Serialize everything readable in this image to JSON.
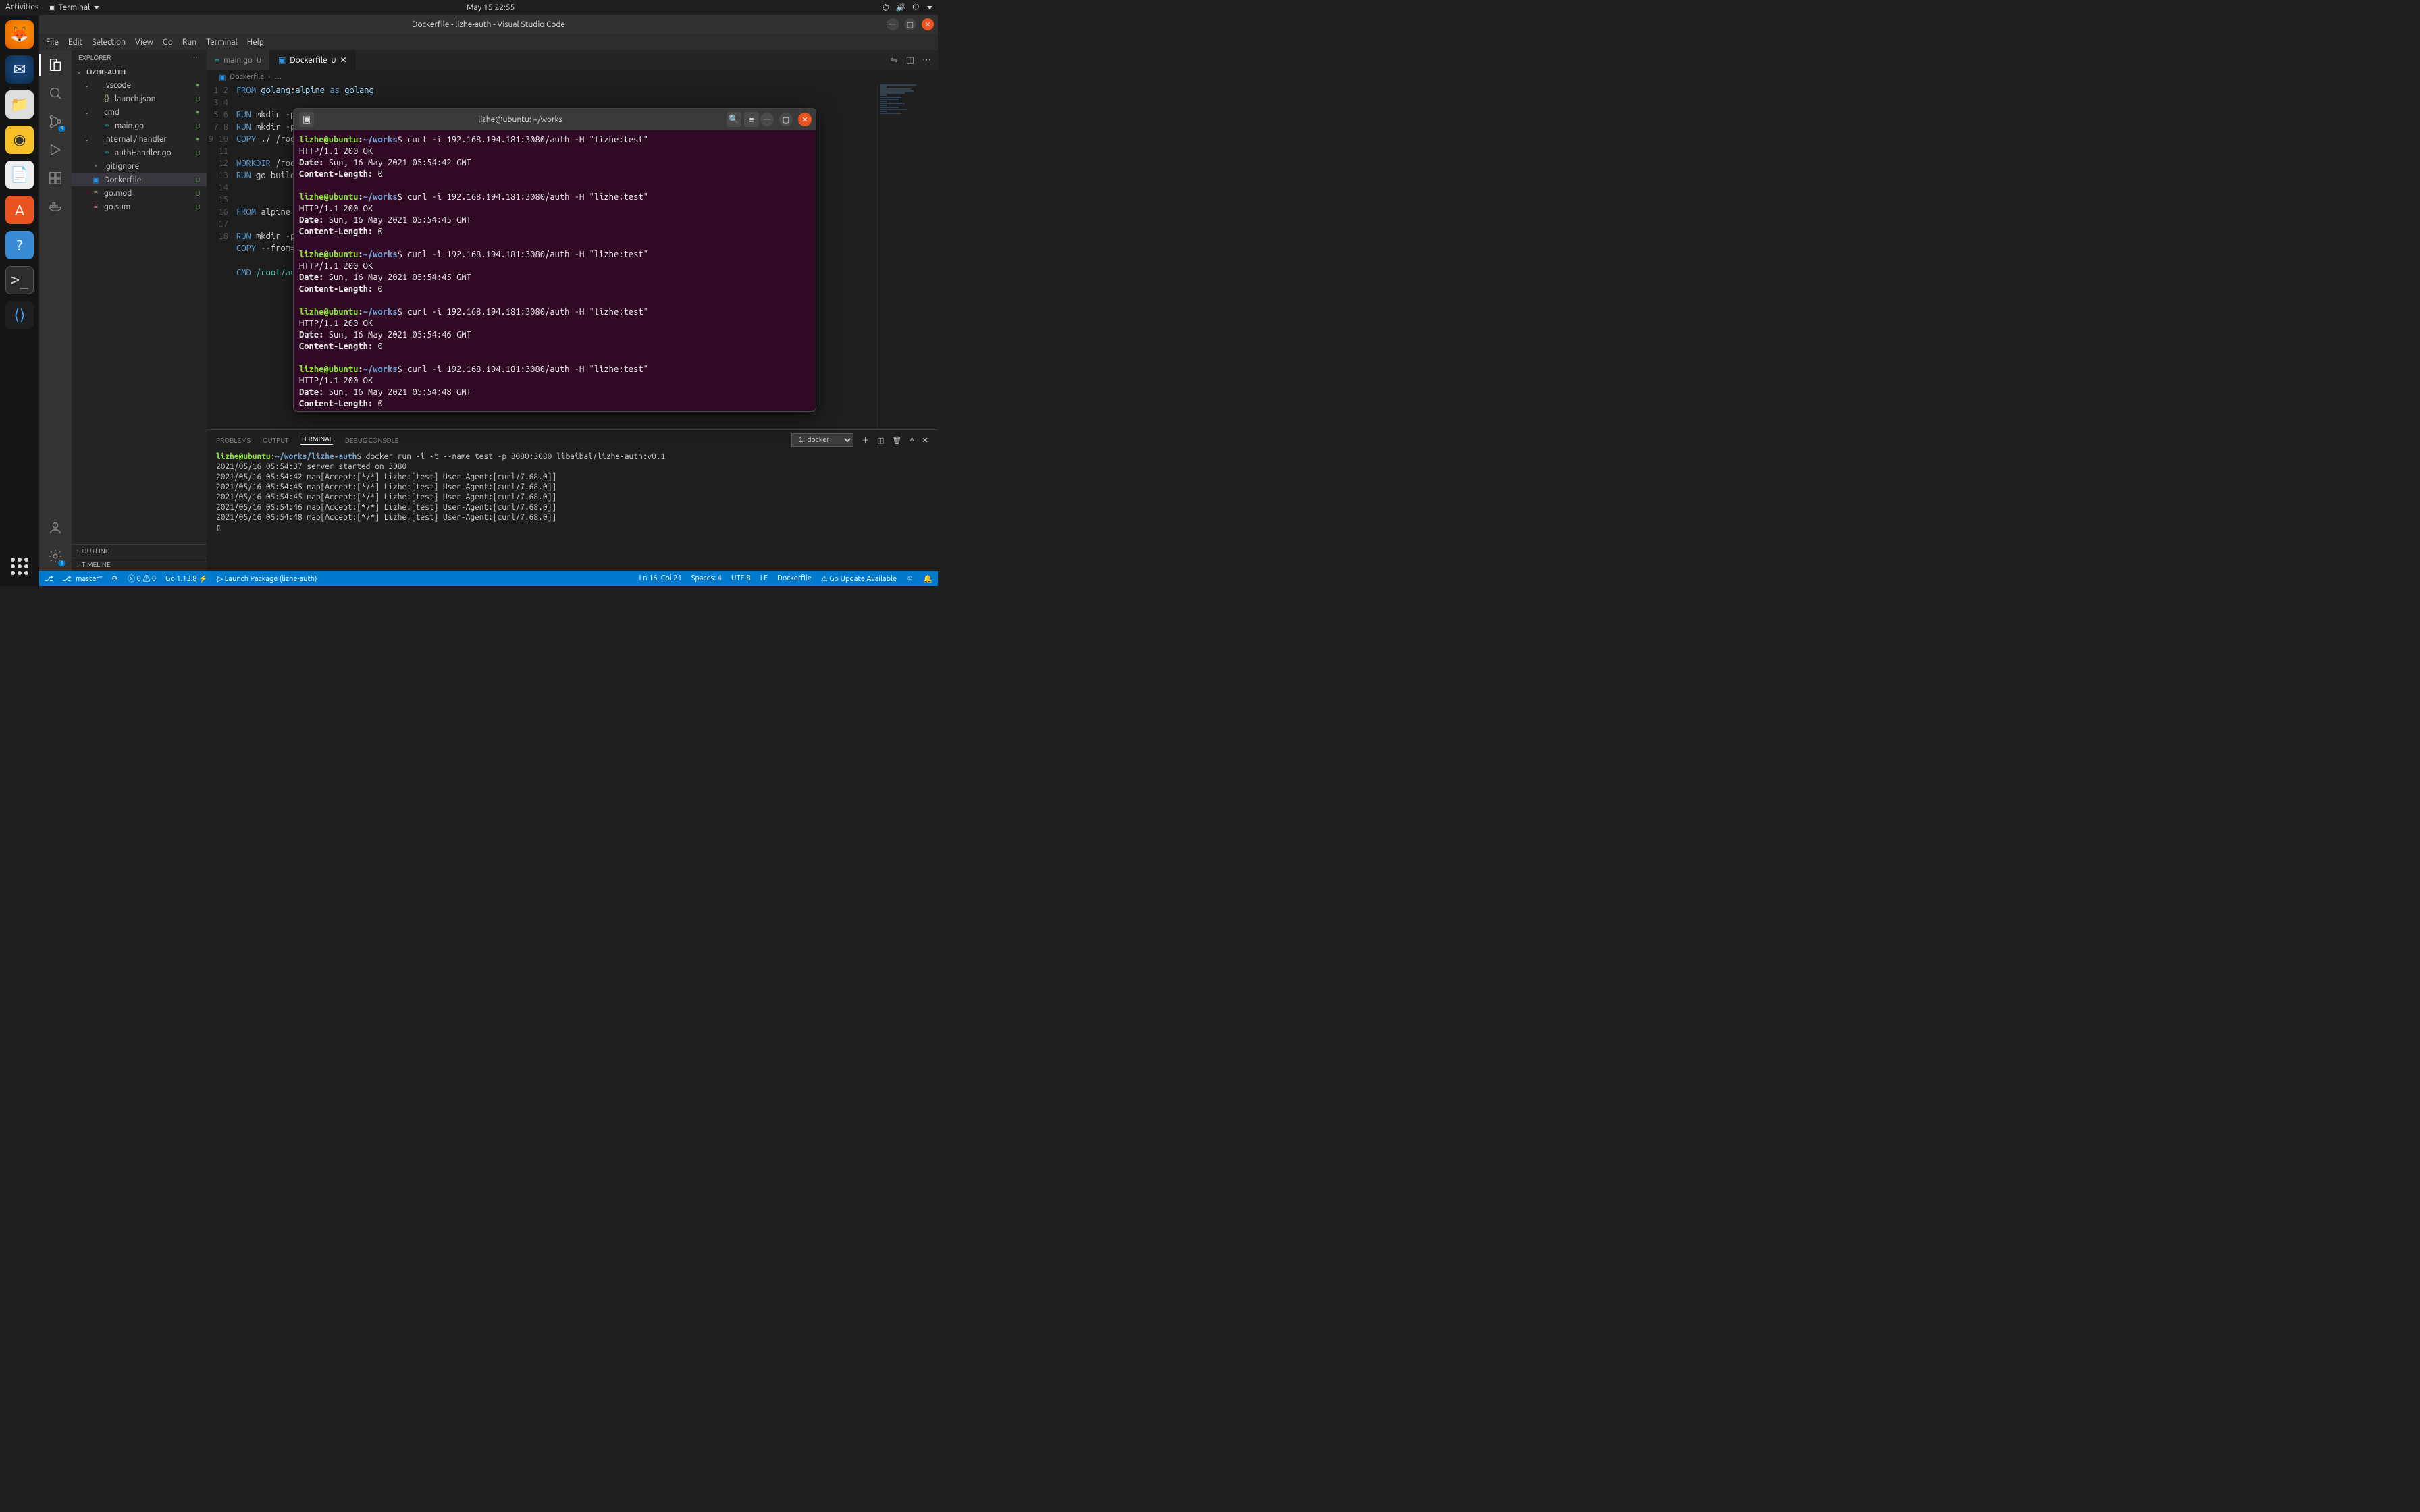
{
  "gnome": {
    "activities": "Activities",
    "app_indicator": "Terminal",
    "clock": "May 15  22:55"
  },
  "dock_icons": [
    "firefox",
    "thunderbird",
    "files",
    "rhythmbox",
    "writer",
    "software",
    "help",
    "terminal",
    "vscode"
  ],
  "vscode": {
    "title": "Dockerfile - lizhe-auth - Visual Studio Code",
    "menu": [
      "File",
      "Edit",
      "Selection",
      "View",
      "Go",
      "Run",
      "Terminal",
      "Help"
    ],
    "explorer": {
      "title": "EXPLORER",
      "root": "LIZHE-AUTH",
      "tree": [
        {
          "depth": 1,
          "type": "folder",
          "open": true,
          "name": ".vscode",
          "status": "●",
          "cls": "dot"
        },
        {
          "depth": 2,
          "type": "file",
          "icon": "{}",
          "iconCls": "json",
          "name": "launch.json",
          "status": "U",
          "cls": "u"
        },
        {
          "depth": 1,
          "type": "folder",
          "open": true,
          "name": "cmd",
          "status": "●",
          "cls": "dot"
        },
        {
          "depth": 2,
          "type": "file",
          "icon": "∞",
          "iconCls": "go",
          "name": "main.go",
          "status": "U",
          "cls": "u"
        },
        {
          "depth": 1,
          "type": "folder",
          "open": true,
          "name": "internal / handler",
          "status": "●",
          "cls": "dot"
        },
        {
          "depth": 2,
          "type": "file",
          "icon": "∞",
          "iconCls": "go",
          "name": "authHandler.go",
          "status": "U",
          "cls": "u"
        },
        {
          "depth": 1,
          "type": "file",
          "icon": "◦",
          "iconCls": "",
          "name": ".gitignore",
          "status": "",
          "cls": ""
        },
        {
          "depth": 1,
          "type": "file",
          "icon": "▣",
          "iconCls": "docker",
          "name": "Dockerfile",
          "status": "U",
          "cls": "u",
          "selected": true
        },
        {
          "depth": 1,
          "type": "file",
          "icon": "≡",
          "iconCls": "mod",
          "name": "go.mod",
          "status": "U",
          "cls": "u"
        },
        {
          "depth": 1,
          "type": "file",
          "icon": "≡",
          "iconCls": "mod",
          "name": "go.sum",
          "status": "U",
          "cls": "u"
        }
      ],
      "outline": "OUTLINE",
      "timeline": "TIMELINE"
    },
    "activitybar_source_badge": "6",
    "tabs": [
      {
        "icon": "∞",
        "iconCls": "go",
        "name": "main.go",
        "modified": true,
        "active": false
      },
      {
        "icon": "▣",
        "iconCls": "docker",
        "name": "Dockerfile",
        "modified": true,
        "active": true
      }
    ],
    "breadcrumb": [
      "Dockerfile",
      "…"
    ],
    "editor_lines": [
      {
        "n": 1,
        "html": "<span class='c-kw'>FROM</span> <span class='c-cmd'>golang</span>:<span class='c-cmd'>alpine</span> <span class='c-kw'>as</span> <span class='c-cmd'>golang</span>"
      },
      {
        "n": 2,
        "html": ""
      },
      {
        "n": 3,
        "html": "<span class='c-kw'>RUN</span> mkdir -p <span class='c-path'>/root/auth</span>"
      },
      {
        "n": 4,
        "html": "<span class='c-kw'>RUN</span> mkdir -p"
      },
      {
        "n": 5,
        "html": "<span class='c-kw'>COPY</span> ./ /root"
      },
      {
        "n": 6,
        "html": ""
      },
      {
        "n": 7,
        "html": "<span class='c-kw'>WORKDIR</span> /root"
      },
      {
        "n": 8,
        "html": "<span class='c-kw'>RUN</span> go build"
      },
      {
        "n": 9,
        "html": ""
      },
      {
        "n": 10,
        "html": ""
      },
      {
        "n": 11,
        "html": "<span class='c-kw'>FROM</span> alpine a"
      },
      {
        "n": 12,
        "html": ""
      },
      {
        "n": 13,
        "html": "<span class='c-kw'>RUN</span> mkdir -p"
      },
      {
        "n": 14,
        "html": "<span class='c-kw'>COPY</span> --from=g"
      },
      {
        "n": 15,
        "html": ""
      },
      {
        "n": 16,
        "html": "<span class='c-kw'>CMD</span> <span class='c-path'>/root/aut</span>"
      },
      {
        "n": 17,
        "html": ""
      },
      {
        "n": 18,
        "html": ""
      }
    ],
    "panel": {
      "tabs": [
        "PROBLEMS",
        "OUTPUT",
        "TERMINAL",
        "DEBUG CONSOLE"
      ],
      "active": "TERMINAL",
      "select": "1: docker",
      "prompt_user": "lizhe@ubuntu",
      "prompt_path": "~/works/lizhe-auth",
      "command": "docker run -i -t --name test -p 3080:3080 libaibai/lizhe-auth:v0.1",
      "output": [
        "2021/05/16 05:54:37 server started on 3080",
        "2021/05/16 05:54:42 map[Accept:[*/*] Lizhe:[test] User-Agent:[curl/7.68.0]]",
        "2021/05/16 05:54:45 map[Accept:[*/*] Lizhe:[test] User-Agent:[curl/7.68.0]]",
        "2021/05/16 05:54:45 map[Accept:[*/*] Lizhe:[test] User-Agent:[curl/7.68.0]]",
        "2021/05/16 05:54:46 map[Accept:[*/*] Lizhe:[test] User-Agent:[curl/7.68.0]]",
        "2021/05/16 05:54:48 map[Accept:[*/*] Lizhe:[test] User-Agent:[curl/7.68.0]]"
      ],
      "cursor": "▯"
    },
    "statusbar": {
      "branch": "master*",
      "errors": "0",
      "warnings": "0",
      "go_ver": "Go 1.13.8",
      "debug_alt": "⚡",
      "launch": "Launch Package (lizhe-auth)",
      "ln_col": "Ln 16, Col 21",
      "spaces": "Spaces: 4",
      "encoding": "UTF-8",
      "eol": "LF",
      "lang": "Dockerfile",
      "go_update": "Go Update Available",
      "notif": "🔔"
    }
  },
  "gnome_terminal": {
    "title": "lizhe@ubuntu: ~/works",
    "prompt_user": "lizhe@ubuntu",
    "prompt_sep": ":",
    "prompt_path": "~/works",
    "requests": [
      {
        "cmd": "curl -i 192.168.194.181:3080/auth -H \"lizhe:test\"",
        "status": "HTTP/1.1 200 OK",
        "date": "Sun, 16 May 2021 05:54:42 GMT",
        "len": "0"
      },
      {
        "cmd": "curl -i 192.168.194.181:3080/auth -H \"lizhe:test\"",
        "status": "HTTP/1.1 200 OK",
        "date": "Sun, 16 May 2021 05:54:45 GMT",
        "len": "0"
      },
      {
        "cmd": "curl -i 192.168.194.181:3080/auth -H \"lizhe:test\"",
        "status": "HTTP/1.1 200 OK",
        "date": "Sun, 16 May 2021 05:54:45 GMT",
        "len": "0"
      },
      {
        "cmd": "curl -i 192.168.194.181:3080/auth -H \"lizhe:test\"",
        "status": "HTTP/1.1 200 OK",
        "date": "Sun, 16 May 2021 05:54:46 GMT",
        "len": "0"
      },
      {
        "cmd": "curl -i 192.168.194.181:3080/auth -H \"lizhe:test\"",
        "status": "HTTP/1.1 200 OK",
        "date": "Sun, 16 May 2021 05:54:48 GMT",
        "len": "0"
      }
    ]
  }
}
